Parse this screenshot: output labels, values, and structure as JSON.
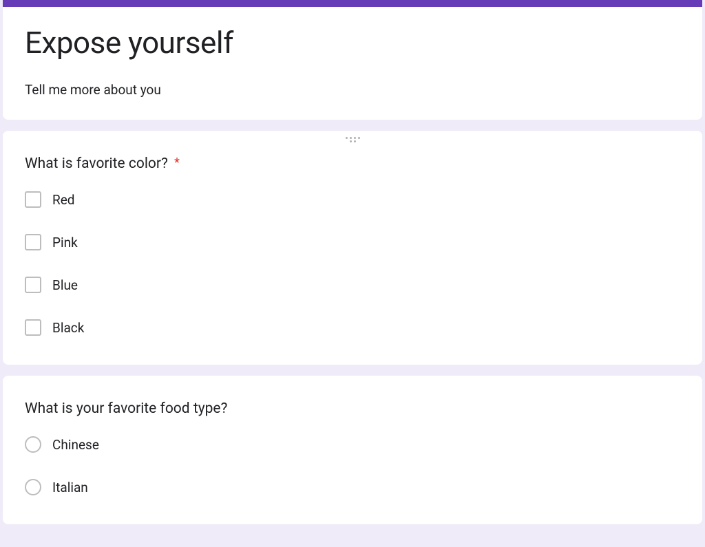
{
  "form": {
    "title": "Expose yourself",
    "description": "Tell me more about you",
    "accent_color": "#673ab7",
    "required_color": "#d93025"
  },
  "questions": [
    {
      "title": "What is favorite color?",
      "required": true,
      "type": "checkbox",
      "options": [
        "Red",
        "Pink",
        "Blue",
        "Black"
      ]
    },
    {
      "title": "What is your favorite food type?",
      "required": false,
      "type": "radio",
      "options": [
        "Chinese",
        "Italian"
      ]
    }
  ]
}
